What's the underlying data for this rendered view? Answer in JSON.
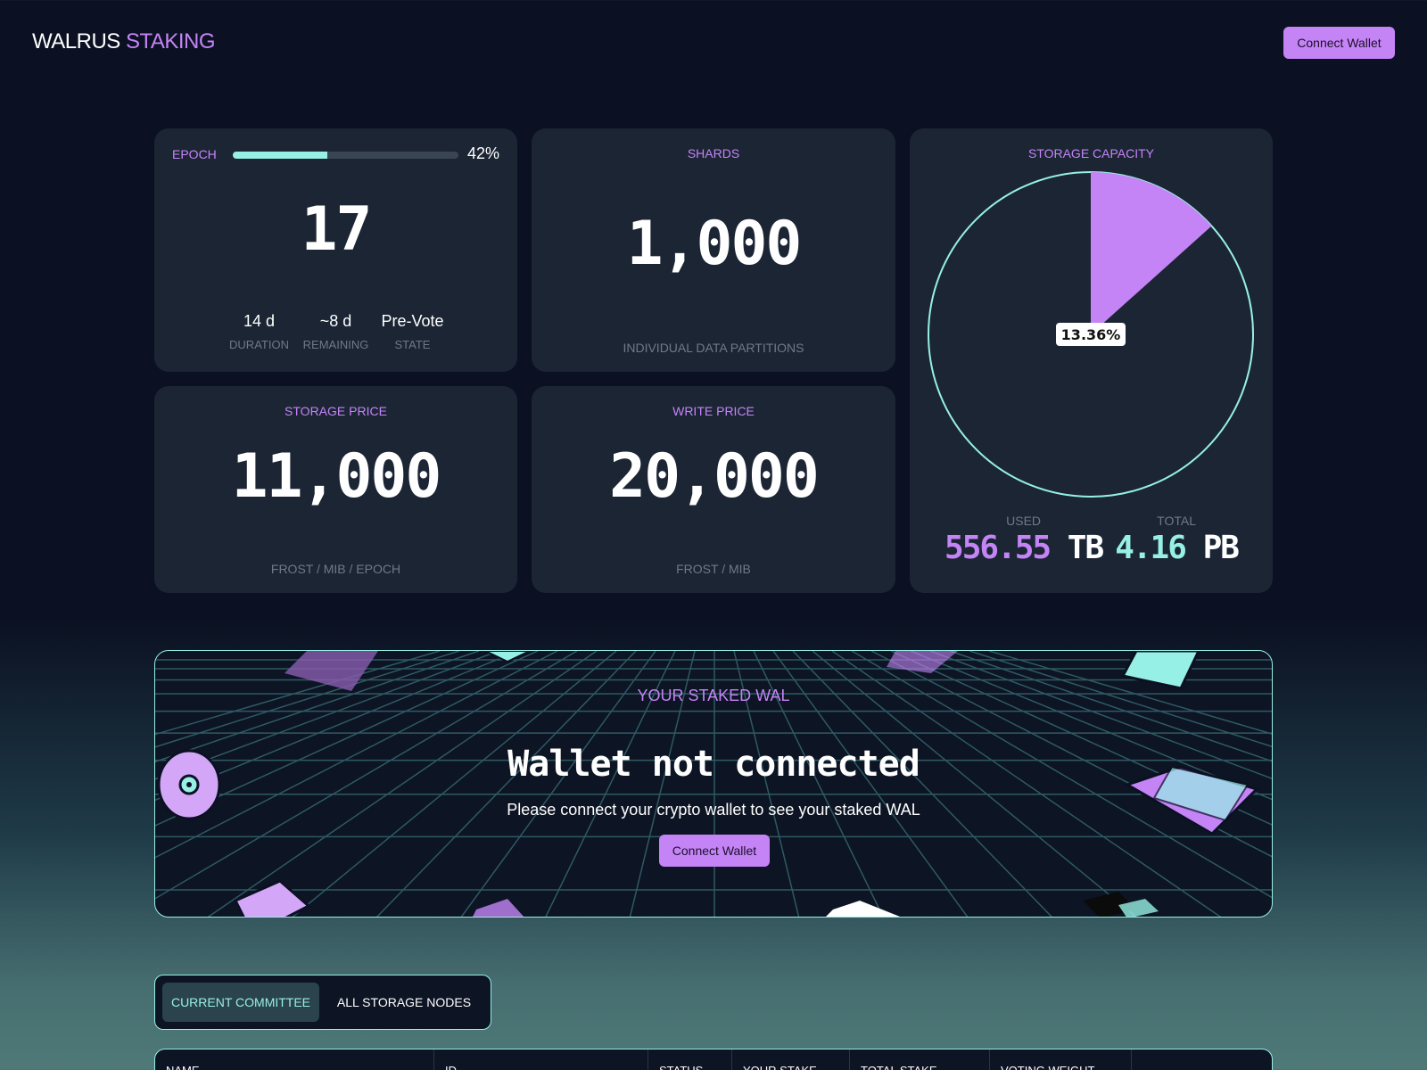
{
  "header": {
    "logo_part1": "WALRUS",
    "logo_part2": "STAKING",
    "connect_label": "Connect Wallet"
  },
  "epoch": {
    "label": "EPOCH",
    "progress": 42,
    "progress_label": "42%",
    "value": "17",
    "stats": [
      {
        "value": "14 d",
        "label": "DURATION"
      },
      {
        "value": "~8 d",
        "label": "REMAINING"
      },
      {
        "value": "Pre-Vote",
        "label": "STATE"
      }
    ]
  },
  "shards": {
    "label": "SHARDS",
    "value": "1,000",
    "caption": "INDIVIDUAL DATA PARTITIONS"
  },
  "storage_price": {
    "label": "STORAGE PRICE",
    "value": "11,000",
    "caption": "FROST / MiB / EPOCH"
  },
  "write_price": {
    "label": "WRITE PRICE",
    "value": "20,000",
    "caption": "FROST / MiB"
  },
  "capacity": {
    "label": "STORAGE CAPACITY",
    "used_fraction": 0.1336,
    "pct_label": "13.36%",
    "used_label": "USED",
    "used_value": "556.55",
    "used_unit": "TB",
    "total_label": "TOTAL",
    "total_value": "4.16",
    "total_unit": "PB",
    "used_color": "#c584f6",
    "total_color": "#97f0e5"
  },
  "staked": {
    "title": "YOUR STAKED WAL",
    "heading": "Wallet not connected",
    "message": "Please connect your crypto wallet to see your staked WAL",
    "connect_label": "Connect Wallet"
  },
  "tabs": [
    {
      "label": "CURRENT COMMITTEE",
      "active": true
    },
    {
      "label": "ALL STORAGE NODES",
      "active": false
    }
  ],
  "table": {
    "columns": [
      "NAME",
      "ID",
      "STATUS",
      "YOUR STAKE",
      "TOTAL STAKE",
      "VOTING WEIGHT"
    ]
  },
  "colors": {
    "accent_purple": "#c584f6",
    "accent_teal": "#97f0e5",
    "card_bg": "#1b2534",
    "page_bg": "#0b1122"
  }
}
